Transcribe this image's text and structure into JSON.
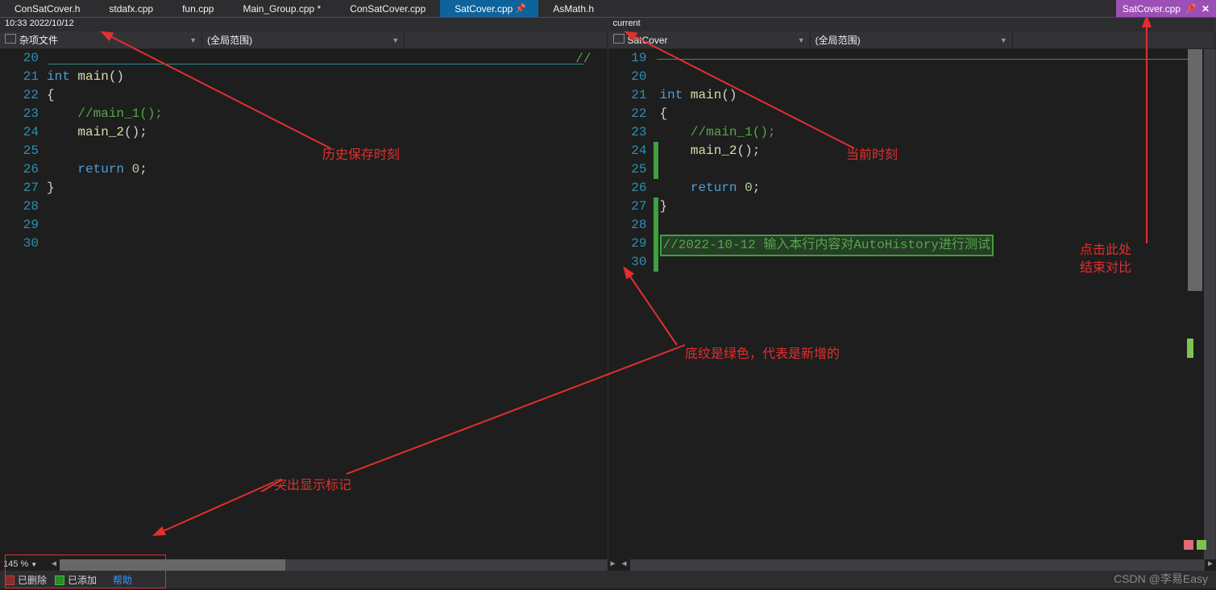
{
  "tabs": [
    {
      "label": "ConSatCover.h",
      "active": false
    },
    {
      "label": "stdafx.cpp",
      "active": false
    },
    {
      "label": "fun.cpp",
      "active": false
    },
    {
      "label": "Main_Group.cpp *",
      "active": false
    },
    {
      "label": "ConSatCover.cpp",
      "active": false
    },
    {
      "label": "SatCover.cpp",
      "active": true
    },
    {
      "label": "AsMath.h",
      "active": false
    }
  ],
  "right_tab": {
    "label": "SatCover.cpp"
  },
  "left_pane": {
    "timestamp": "10:33 2022/10/12",
    "nav1": "杂项文件",
    "nav2": "(全局范围)",
    "lines": [
      {
        "n": 20,
        "html": ""
      },
      {
        "n": 21,
        "html": "<span class='kw'>int</span> <span class='fn'>main</span><span class='plain'>()</span>"
      },
      {
        "n": 22,
        "html": "<span class='plain'>{</span>"
      },
      {
        "n": 23,
        "html": "    <span class='cm'>//main_1();</span>"
      },
      {
        "n": 24,
        "html": "    <span class='fn'>main_2</span><span class='plain'>();</span>"
      },
      {
        "n": 25,
        "html": ""
      },
      {
        "n": 26,
        "html": "    <span class='kw'>return</span> <span class='num'>0</span><span class='plain'>;</span>"
      },
      {
        "n": 27,
        "html": "<span class='plain'>}</span>"
      },
      {
        "n": 28,
        "html": ""
      },
      {
        "n": 29,
        "html": ""
      },
      {
        "n": 30,
        "html": ""
      }
    ]
  },
  "right_pane": {
    "sub_header": "current",
    "nav1": "SatCover",
    "nav2": "(全局范围)",
    "lines": [
      {
        "n": 19,
        "html": "",
        "changed": false
      },
      {
        "n": 20,
        "html": "",
        "changed": false
      },
      {
        "n": 21,
        "html": "<span class='kw'>int</span> <span class='fn'>main</span><span class='plain'>()</span>",
        "changed": false
      },
      {
        "n": 22,
        "html": "<span class='plain'>{</span>",
        "changed": false
      },
      {
        "n": 23,
        "html": "    <span class='cm'>//main_1();</span>",
        "changed": false
      },
      {
        "n": 24,
        "html": "    <span class='fn'>main_2</span><span class='plain'>();</span>",
        "changed": true
      },
      {
        "n": 25,
        "html": "",
        "changed": true
      },
      {
        "n": 26,
        "html": "    <span class='kw'>return</span> <span class='num'>0</span><span class='plain'>;</span>",
        "changed": false
      },
      {
        "n": 27,
        "html": "<span class='plain'>}</span>",
        "changed": true
      },
      {
        "n": 28,
        "html": "",
        "changed": true
      },
      {
        "n": 29,
        "html": "<span class='highlighted-line cm'>//2022-10-12 输入本行内容对AutoHistory进行测试</span>",
        "changed": true
      },
      {
        "n": 30,
        "html": "",
        "changed": true
      }
    ]
  },
  "zoom": "145 %",
  "legend": {
    "deleted": "已删除",
    "added": "已添加",
    "help": "帮助"
  },
  "annotations": {
    "a1": "历史保存时刻",
    "a2": "当前时刻",
    "a3": "点击此处",
    "a3b": "结束对比",
    "a4": "突出显示标记",
    "a5": "底纹是绿色，代表是新增的"
  },
  "watermark": "CSDN @李易Easy"
}
